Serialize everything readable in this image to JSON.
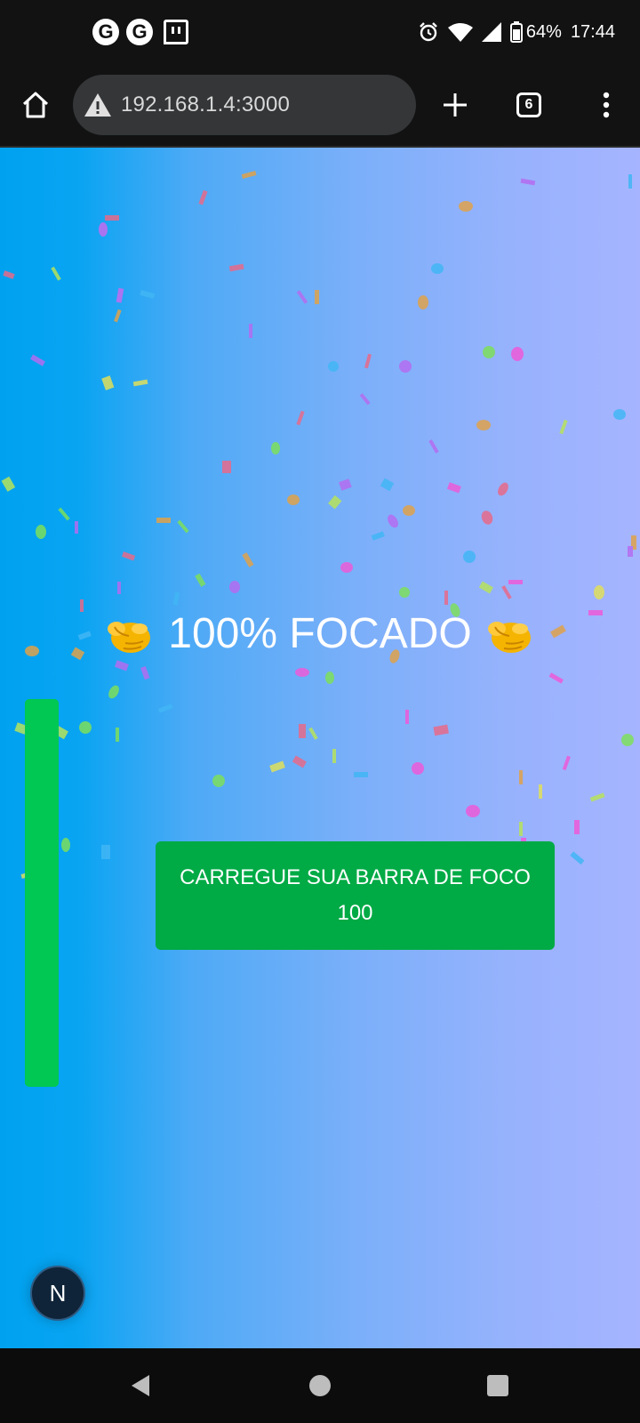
{
  "status_bar": {
    "notification_icons": [
      "google-g-icon",
      "google-g-icon",
      "twitch-icon"
    ],
    "notification_glyph": "G",
    "battery_percent": "64%",
    "time": "17:44"
  },
  "browser": {
    "url": "192.168.1.4:3000",
    "tab_count": "6"
  },
  "page": {
    "headline": "100% FOCADO",
    "headline_emoji": "point-at-viewer-hand-icon",
    "button_line1": "CARREGUE SUA BARRA DE FOCO",
    "button_line2": "100",
    "focus_level": 1.0,
    "fab_letter": "N"
  },
  "colors": {
    "button_green": "#00aa45",
    "bar_green": "#00c853",
    "gradient_start": "#00a2f0",
    "gradient_end": "#a6b4ff"
  }
}
